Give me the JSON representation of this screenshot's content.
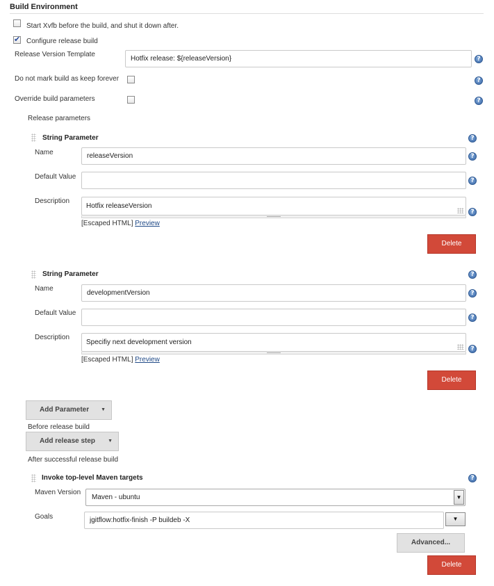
{
  "section": {
    "title": "Build Environment"
  },
  "options": {
    "xvfb_label": "Start Xvfb before the build, and shut it down after.",
    "configure_release_label": "Configure release build",
    "release_version_template_label": "Release Version Template",
    "release_version_template_value": "Hotfix release: ${releaseVersion}",
    "keep_forever_label": "Do not mark build as keep forever",
    "override_params_label": "Override build parameters",
    "release_parameters_label": "Release parameters"
  },
  "params": [
    {
      "header": "String Parameter",
      "name_label": "Name",
      "name_value": "releaseVersion",
      "default_label": "Default Value",
      "default_value": "",
      "description_label": "Description",
      "description_value": "Hotfix releaseVersion",
      "escaped": "[Escaped HTML]",
      "preview": "Preview",
      "delete": "Delete"
    },
    {
      "header": "String Parameter",
      "name_label": "Name",
      "name_value": "developmentVersion",
      "default_label": "Default Value",
      "default_value": "",
      "description_label": "Description",
      "description_value": "Specifiy next development version",
      "escaped": "[Escaped HTML]",
      "preview": "Preview",
      "delete": "Delete"
    }
  ],
  "add_parameter": {
    "label": "Add Parameter"
  },
  "before_release_label": "Before release build",
  "add_release_step": {
    "label": "Add release step"
  },
  "after_success_label": "After successful release build",
  "maven": {
    "header": "Invoke top-level Maven targets",
    "version_label": "Maven Version",
    "version_value": "Maven - ubuntu",
    "goals_label": "Goals",
    "goals_value": "jgitflow:hotfix-finish -P buildeb -X",
    "advanced": "Advanced...",
    "delete": "Delete"
  },
  "icons": {
    "help": "help-icon",
    "checkbox": "checkbox",
    "drag": "drag-handle-icon",
    "caret": "caret-down-icon"
  },
  "colors": {
    "delete_button": "#d24939",
    "help_icon": "#3d6aaa",
    "link": "#204a87"
  }
}
